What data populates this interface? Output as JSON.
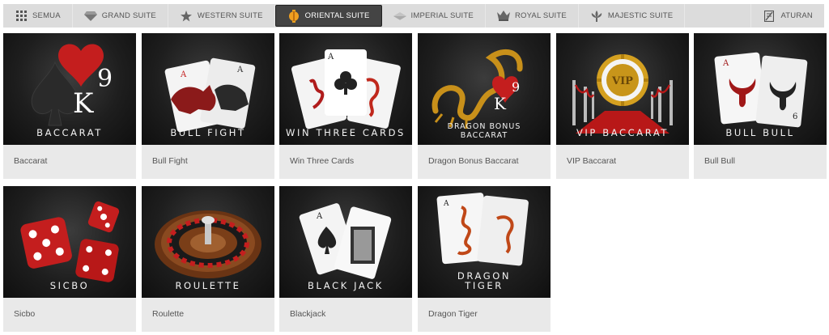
{
  "tabs": [
    {
      "label": "SEMUA",
      "icon": "grid-icon"
    },
    {
      "label": "GRAND SUITE",
      "icon": "diamond-icon"
    },
    {
      "label": "WESTERN SUITE",
      "icon": "star-icon"
    },
    {
      "label": "ORIENTAL SUITE",
      "icon": "lantern-icon",
      "active": true
    },
    {
      "label": "IMPERIAL SUITE",
      "icon": "gem-icon"
    },
    {
      "label": "ROYAL SUITE",
      "icon": "crown-icon"
    },
    {
      "label": "MAJESTIC SUITE",
      "icon": "fleur-icon"
    }
  ],
  "rules_label": "ATURAN",
  "games": [
    {
      "thumb": "BACCARAT",
      "name": "Baccarat"
    },
    {
      "thumb": "BULL FIGHT",
      "name": "Bull Fight"
    },
    {
      "thumb": "WIN THREE CARDS",
      "name": "Win Three Cards"
    },
    {
      "thumb_line1": "DRAGON BONUS",
      "thumb_line2": "BACCARAT",
      "name": "Dragon Bonus Baccarat"
    },
    {
      "thumb": "VIP BACCARAT",
      "name": "VIP Baccarat",
      "chip_text": "VIP"
    },
    {
      "thumb": "BULL BULL",
      "name": "Bull Bull"
    },
    {
      "thumb": "SICBO",
      "name": "Sicbo"
    },
    {
      "thumb": "ROULETTE",
      "name": "Roulette"
    },
    {
      "thumb": "BLACK JACK",
      "name": "Blackjack"
    },
    {
      "thumb_line1": "DRAGON",
      "thumb_line2": "TIGER",
      "name": "Dragon Tiger"
    }
  ],
  "card_marks": {
    "k": "K",
    "nine": "9",
    "a": "A",
    "six": "6"
  },
  "colors": {
    "tab_bar": "#dcdcdc",
    "active_tab": "#444444",
    "card_bg": "#e9e9e9",
    "accent_red": "#c41e1e",
    "gold": "#d4a020"
  }
}
